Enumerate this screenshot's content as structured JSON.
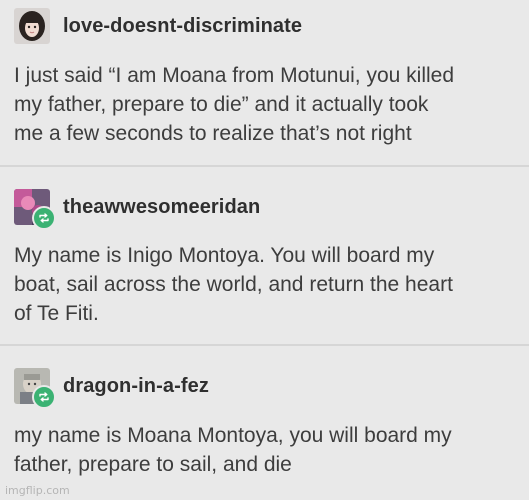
{
  "posts": [
    {
      "username": "love-doesnt-discriminate",
      "avatar_icon": "user-avatar-icon",
      "reblog": false,
      "text": "I just said “I am Moana from Motunui, you killed\nmy father, prepare to die” and it actually took\nme a few seconds to realize that’s not right"
    },
    {
      "username": "theawwesomeeridan",
      "avatar_icon": "user-avatar-icon",
      "reblog": true,
      "text": "My name is Inigo Montoya. You will board my\nboat, sail across the world, and return the heart\nof Te Fiti."
    },
    {
      "username": "dragon-in-a-fez",
      "avatar_icon": "user-avatar-icon",
      "reblog": true,
      "text": "my name is Moana Montoya, you will board my\nfather, prepare to sail, and die"
    }
  ],
  "watermark": "imgflip.com",
  "colors": {
    "background": "#e9e9e9",
    "reblog_badge": "#3bb273",
    "text": "#3d3d3d"
  }
}
